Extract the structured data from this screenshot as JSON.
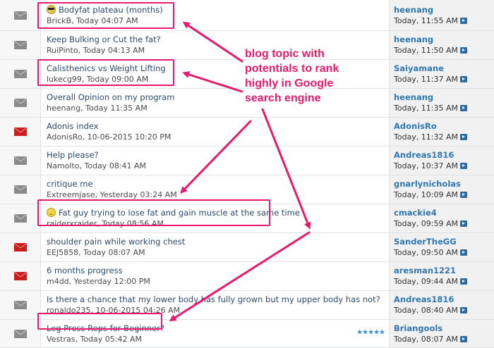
{
  "topics": [
    {
      "icon": "envelope-read-icon",
      "emoji": "cool",
      "title": "Bodyfat plateau (months)",
      "meta": "BrickB, Today 04:07 AM",
      "last_user": "heenang",
      "last_time": "Today, 11:55 AM"
    },
    {
      "icon": "envelope-read-icon",
      "emoji": "",
      "title": "Keep Bulking or Cut the fat?",
      "meta": "RuiPinto, Today 04:13 AM",
      "last_user": "heenang",
      "last_time": "Today, 11:50 AM"
    },
    {
      "icon": "envelope-read-icon",
      "emoji": "",
      "title": "Calisthenics vs Weight Lifting",
      "meta": "lukecg99, Today 09:00 AM",
      "last_user": "Saiyamane",
      "last_time": "Today, 11:37 AM"
    },
    {
      "icon": "envelope-read-icon",
      "emoji": "",
      "title": "Overall Opinion on my program",
      "meta": "heenang, Today 11:35 AM",
      "last_user": "heenang",
      "last_time": "Today, 11:35 AM"
    },
    {
      "icon": "envelope-hot-icon",
      "emoji": "",
      "title": "Adonis index",
      "meta": "AdonisRo, 10-06-2015 10:20 PM",
      "last_user": "AdonisRo",
      "last_time": "Today, 11:32 AM"
    },
    {
      "icon": "envelope-read-icon",
      "emoji": "",
      "title": "Help please?",
      "meta": "Namolto, Today 08:41 AM",
      "last_user": "Andreas1816",
      "last_time": "Today, 10:37 AM"
    },
    {
      "icon": "envelope-read-icon",
      "emoji": "",
      "title": "critique me",
      "meta": "Extreemjase, Yesterday 03:24 AM",
      "last_user": "gnarlynicholas",
      "last_time": "Today, 10:09 AM"
    },
    {
      "icon": "envelope-read-icon",
      "emoji": "smile",
      "title": "Fat guy trying to lose fat and gain muscle at the same time",
      "meta": "raiderxraider, Today 08:56 AM",
      "last_user": "cmackie4",
      "last_time": "Today, 09:59 AM"
    },
    {
      "icon": "envelope-hot-icon",
      "emoji": "",
      "title": "shoulder pain while working chest",
      "meta": "EEJ5858, Today 08:07 AM",
      "last_user": "SanderTheGG",
      "last_time": "Today, 09:50 AM"
    },
    {
      "icon": "envelope-hot-icon",
      "emoji": "",
      "title": "6 months progress",
      "meta": "m4dd, Yesterday 12:00 PM",
      "last_user": "aresman1221",
      "last_time": "Today, 09:44 AM"
    },
    {
      "icon": "envelope-read-icon",
      "emoji": "",
      "title": "Is there a chance that my lower body has fully grown but my upper body has not?",
      "meta": "ronaldo235, 10-06-2015 04:26 AM",
      "last_user": "Andreas1816",
      "last_time": "Today, 08:40 AM"
    },
    {
      "icon": "envelope-read-icon",
      "emoji": "",
      "title": "Leg Press Reps for Beginner?",
      "meta": "Vestras, Today 05:42 AM",
      "last_user": "Briangools",
      "last_time": "Today, 08:07 AM",
      "stars": "★★★★★"
    }
  ],
  "annotation": {
    "line1": "blog topic with",
    "line2": "potentials to rank",
    "line3": "highly in Google",
    "line4": "search engine",
    "color": "#e8196a"
  },
  "colors": {
    "topic_link": "#2b4b6e",
    "user_link": "#2f78b5",
    "highlight": "#e8196a",
    "envelope_read": "#8a8a8a",
    "envelope_hot": "#cc1d1d"
  }
}
